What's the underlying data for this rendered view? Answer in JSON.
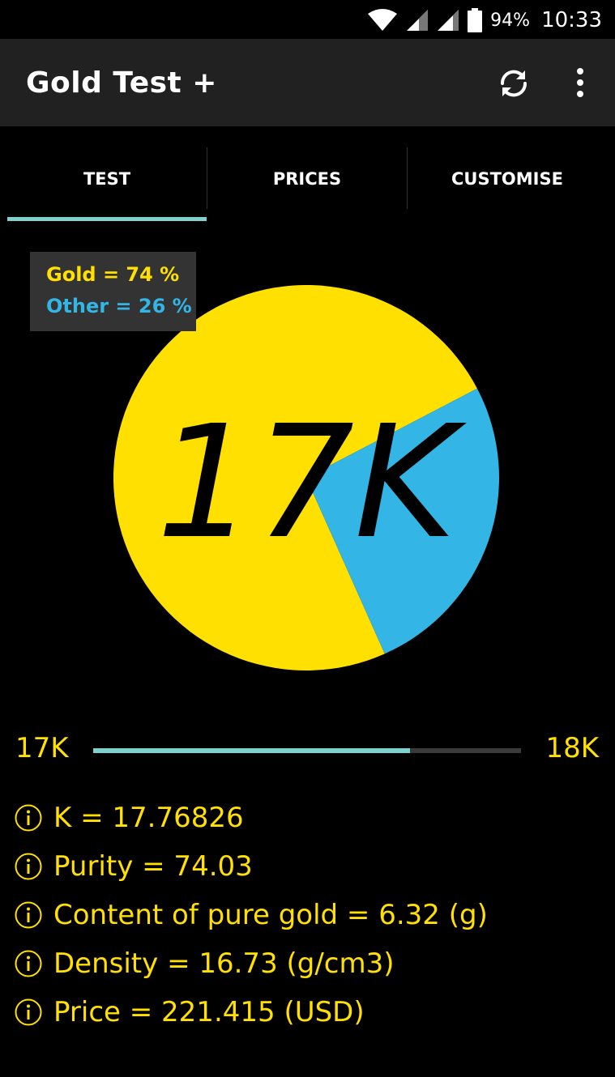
{
  "status_bar": {
    "battery": "94%",
    "time": "10:33"
  },
  "app_bar": {
    "title": "Gold Test +",
    "actions": [
      {
        "icon": "refresh-icon"
      },
      {
        "icon": "more-vert-icon"
      }
    ]
  },
  "tabs": [
    {
      "label": "TEST",
      "selected": true
    },
    {
      "label": "PRICES",
      "selected": false
    },
    {
      "label": "CUSTOMISE",
      "selected": false
    }
  ],
  "chart_data": {
    "type": "pie",
    "categories": [
      "Gold",
      "Other"
    ],
    "values": [
      74,
      26
    ],
    "colors": [
      "#ffe000",
      "#33b5e5"
    ],
    "center_label": "17K",
    "legend": [
      "Gold = 74 %",
      "Other = 26 %"
    ],
    "legend_position": "top-left"
  },
  "range": {
    "min_label": "17K",
    "max_label": "18K",
    "progress": 0.74
  },
  "info": [
    {
      "text": "K = 17.76826",
      "icon": "info-icon"
    },
    {
      "text": "Purity = 74.03",
      "icon": "info-icon"
    },
    {
      "text": "Content of pure gold = 6.32 (g)",
      "icon": "info-icon"
    },
    {
      "text": "Density = 16.73 (g/cm3)",
      "icon": "info-icon"
    },
    {
      "text": "Price = 221.415 (USD)",
      "icon": "info-icon"
    }
  ],
  "colors": {
    "accent": "#7fd1cd",
    "gold": "#ffe000",
    "other": "#33b5e5",
    "app_bar": "#212121"
  }
}
